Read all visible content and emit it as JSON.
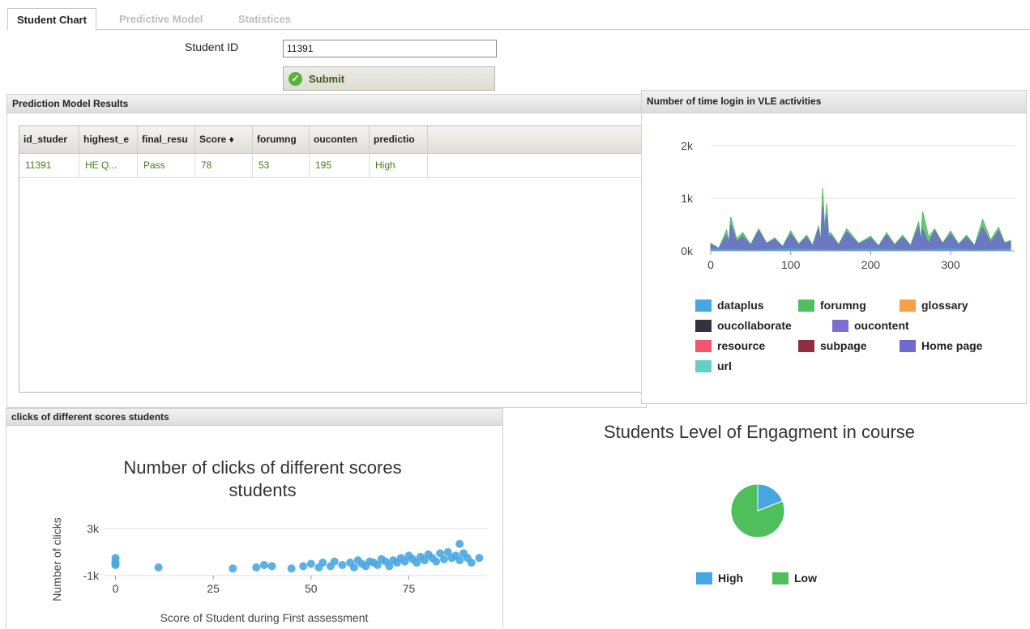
{
  "tabs": [
    {
      "label": "Student Chart",
      "active": true
    },
    {
      "label": "Predictive Model",
      "active": false
    },
    {
      "label": "Statistices",
      "active": false
    }
  ],
  "form": {
    "student_id_label": "Student ID",
    "student_id_value": "11391",
    "submit_label": "Submit"
  },
  "results_panel": {
    "title": "Prediction Model Results",
    "columns": [
      "id_studer",
      "highest_e",
      "final_resu",
      "Score ♦",
      "forumng",
      "ouconten",
      "predictio"
    ],
    "rows": [
      [
        "11391",
        "HE Q...",
        "Pass",
        "78",
        "53",
        "195",
        "High"
      ]
    ]
  },
  "login_panel": {
    "title": "Number of time login in VLE activities",
    "y_ticks": [
      "2k",
      "1k",
      "0k"
    ],
    "x_ticks": [
      "0",
      "100",
      "200",
      "300"
    ],
    "legend": [
      {
        "label": "dataplus",
        "color": "#45a6e0"
      },
      {
        "label": "forumng",
        "color": "#4fbf5e"
      },
      {
        "label": "glossary",
        "color": "#f5a04a"
      },
      {
        "label": "oucollaborate",
        "color": "#2f3440"
      },
      {
        "label": "oucontent",
        "color": "#7b70cf"
      },
      {
        "label": "resource",
        "color": "#f0576e"
      },
      {
        "label": "subpage",
        "color": "#8d2f3f"
      },
      {
        "label": "Home page",
        "color": "#6f6ad0"
      },
      {
        "label": "url",
        "color": "#63cfc9"
      }
    ]
  },
  "clicks_panel": {
    "header": "clicks of different scores students",
    "title_line1": "Number of clicks of different scores",
    "title_line2": "students",
    "ylabel": "Number of clicks",
    "xlabel": "Score of Student during First assessment",
    "y_ticks": [
      "3k",
      "-1k"
    ],
    "x_ticks": [
      "0",
      "25",
      "50",
      "75"
    ]
  },
  "engagement": {
    "title": "Students Level of Engagment in course",
    "legend": [
      {
        "label": "High",
        "color": "#45a6e0"
      },
      {
        "label": "Low",
        "color": "#4fbf5e"
      }
    ]
  },
  "chart_data": [
    {
      "type": "area",
      "title": "Number of time login in VLE activities",
      "xlim": [
        0,
        380
      ],
      "ylim": [
        0,
        2000
      ],
      "grid": true,
      "legend_position": "bottom",
      "series": [
        {
          "name": "forumng",
          "x": [
            0,
            20,
            25,
            40,
            60,
            80,
            100,
            120,
            135,
            140,
            145,
            150,
            170,
            200,
            220,
            240,
            260,
            265,
            280,
            300,
            320,
            340,
            360,
            375
          ],
          "values": [
            150,
            400,
            650,
            350,
            420,
            250,
            380,
            300,
            480,
            1200,
            900,
            350,
            420,
            280,
            350,
            300,
            560,
            750,
            420,
            380,
            300,
            600,
            450,
            200
          ]
        },
        {
          "name": "Home page",
          "x": [
            0,
            20,
            25,
            40,
            60,
            80,
            100,
            120,
            135,
            140,
            145,
            150,
            170,
            200,
            220,
            240,
            260,
            265,
            280,
            300,
            320,
            340,
            360,
            375
          ],
          "values": [
            120,
            300,
            500,
            280,
            380,
            220,
            320,
            260,
            420,
            850,
            700,
            300,
            360,
            240,
            300,
            260,
            460,
            420,
            380,
            320,
            260,
            450,
            380,
            180
          ]
        },
        {
          "name": "dataplus",
          "x": [
            0,
            100,
            200,
            300,
            375
          ],
          "values": [
            40,
            40,
            40,
            40,
            40
          ]
        }
      ]
    },
    {
      "type": "scatter",
      "title": "Number of clicks of different scores students",
      "xlabel": "Score of Student during First assessment",
      "ylabel": "Number of clicks",
      "xlim": [
        -3,
        95
      ],
      "ylim": [
        -1000,
        3000
      ],
      "grid": true,
      "series": [
        {
          "name": "",
          "x": [
            0,
            0,
            0,
            0,
            11,
            30,
            36,
            38,
            40,
            45,
            48,
            50,
            52,
            53,
            55,
            56,
            58,
            60,
            61,
            62,
            63,
            64,
            65,
            66,
            67,
            68,
            69,
            70,
            71,
            72,
            73,
            74,
            75,
            76,
            77,
            78,
            79,
            80,
            81,
            82,
            83,
            84,
            85,
            86,
            87,
            88,
            88,
            89,
            90,
            91,
            93
          ],
          "y": [
            200,
            -100,
            500,
            0,
            -300,
            -400,
            -300,
            -100,
            -200,
            -400,
            -200,
            0,
            -300,
            100,
            -200,
            200,
            -100,
            100,
            -300,
            300,
            0,
            -200,
            200,
            100,
            -100,
            400,
            200,
            -200,
            300,
            100,
            500,
            200,
            700,
            400,
            100,
            600,
            300,
            800,
            500,
            200,
            900,
            400,
            1000,
            500,
            700,
            1700,
            300,
            900,
            500,
            100,
            500
          ]
        }
      ]
    },
    {
      "type": "pie",
      "title": "Students Level of Engagment in course",
      "categories": [
        "High",
        "Low"
      ],
      "values": [
        19,
        81
      ],
      "legend_position": "bottom"
    }
  ]
}
